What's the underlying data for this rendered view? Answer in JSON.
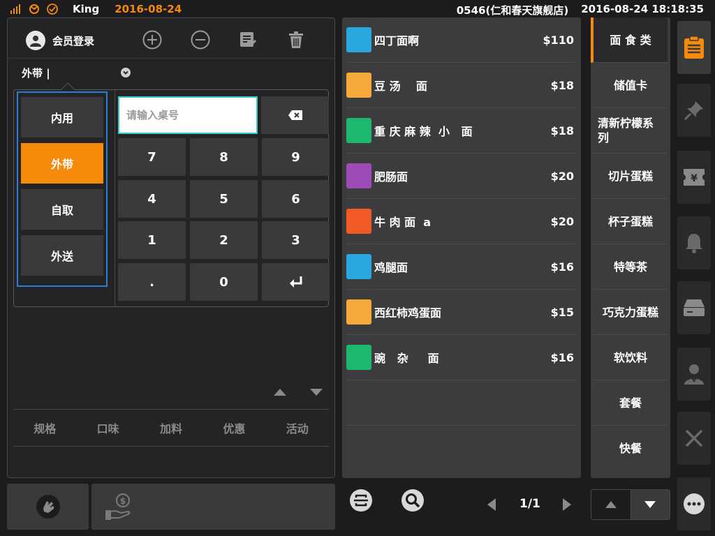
{
  "status": {
    "user": "King",
    "date": "2016-08-24",
    "store": "0546(仁和春天旗舰店)",
    "datetime": "2016-08-24 18:18:35"
  },
  "toolbar": {
    "member_login": "会员登录"
  },
  "order_mode": {
    "current": "外带 |",
    "options": [
      "内用",
      "外带",
      "自取",
      "外送"
    ],
    "active_index": 1
  },
  "keypad": {
    "placeholder": "请输入桌号",
    "keys": [
      "7",
      "8",
      "9",
      "4",
      "5",
      "6",
      "1",
      "2",
      "3",
      ".",
      "0"
    ]
  },
  "item_tabs": [
    "规格",
    "口味",
    "加料",
    "优惠",
    "活动"
  ],
  "products": [
    {
      "name": "四丁面啊",
      "price": "$110",
      "color": "#29a8e0"
    },
    {
      "name": "豆 汤    面",
      "price": "$18",
      "color": "#f5a93a"
    },
    {
      "name": "重 庆 麻 辣  小   面",
      "price": "$18",
      "color": "#1db870"
    },
    {
      "name": "肥肠面",
      "price": "$20",
      "color": "#9d4bb6"
    },
    {
      "name": "牛 肉 面  a",
      "price": "$20",
      "color": "#f15a24"
    },
    {
      "name": "鸡腿面",
      "price": "$16",
      "color": "#29a8e0"
    },
    {
      "name": "西红柿鸡蛋面",
      "price": "$15",
      "color": "#f5a93a"
    },
    {
      "name": "豌   杂     面",
      "price": "$16",
      "color": "#1db870"
    }
  ],
  "pagination": "1/1",
  "categories": [
    "面 食 类",
    "储值卡",
    "清新柠檬系列",
    "切片蛋糕",
    "杯子蛋糕",
    "特等茶",
    "巧克力蛋糕",
    "软饮料",
    "套餐",
    "快餐"
  ],
  "active_category": 0,
  "colors": {
    "accent": "#f58a0b",
    "highlight": "#2e7fd1"
  }
}
